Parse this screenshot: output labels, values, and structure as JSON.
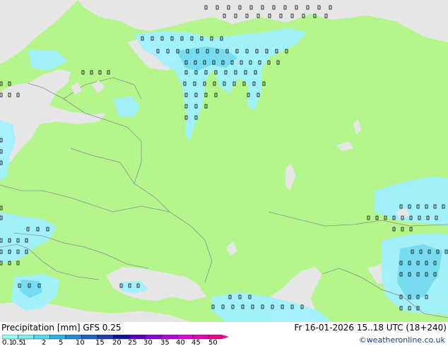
{
  "footer": {
    "title_left": "Precipitation [mm] GFS 0.25",
    "title_right": "Fr 16-01-2026 15..18 UTC (18+240)",
    "copyright": "©weatheronline.co.uk"
  },
  "legend": {
    "labels": [
      "0.1",
      "0.5",
      "1",
      "2",
      "5",
      "10",
      "15",
      "20",
      "25",
      "30",
      "35",
      "40",
      "45",
      "50"
    ],
    "colors": [
      "#96fff5",
      "#78f0f0",
      "#50dcf0",
      "#28b4e6",
      "#1e8cdc",
      "#1e64c8",
      "#1e3cb4",
      "#1414a0",
      "#5a00c8",
      "#8c00dc",
      "#b400dc",
      "#dc00dc",
      "#e600b4",
      "#f0008c"
    ]
  },
  "map_colors": {
    "land": "#b4f58c",
    "sea": "#e6e6e6",
    "precip_light": "#a0f0ff",
    "precip_mid": "#78dcf0",
    "border": "#8c8c8c"
  }
}
